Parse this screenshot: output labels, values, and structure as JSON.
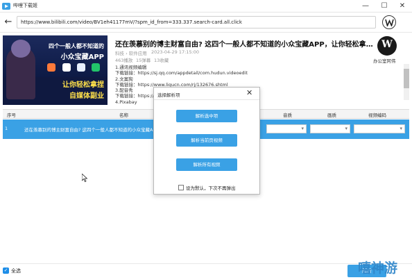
{
  "window": {
    "title": "哔哩下载姬",
    "minimize_icon": "minimize-icon",
    "maximize_icon": "maximize-icon",
    "close_icon": "close-icon"
  },
  "address": {
    "url": "https://www.bilibili.com/video/BV1eh41177mV/?spm_id_from=333.337.search-card.all.click"
  },
  "video": {
    "thumbnail_lines": [
      "四个一般人都不知道的",
      "小众宝藏APP",
      "让你轻松拿捏",
      "自媒体副业"
    ],
    "title": "还在羡慕别的博主财富自由? 这四个一般人都不知道的小众宝藏APP，让你轻松拿捏自媒体...",
    "category": "科技 › 软件应用",
    "date": "2023-04-29 17:15:00",
    "stats": [
      "463播放",
      "15弹幕",
      "13收藏"
    ],
    "description": [
      "1.通讯视频编辑",
      "下载链接：https://sj.qq.com/appdetail/com.hudun.videoedit",
      "2.文案狗",
      "下载链接：https://www.liqucn.com/rj/132676.shtml",
      "3.配音秀",
      "下载链接：https://",
      "4.Pixabay"
    ],
    "channel_name": "办公室阿伟",
    "channel_logo_text": "W"
  },
  "table": {
    "headers": [
      "序号",
      "名称",
      "音质",
      "画质",
      "视频编码"
    ],
    "rows": [
      {
        "index": "1",
        "name": "还在羡慕别的博主财富自由? 这四个一般人都不知道的小众宝藏APP，让你...",
        "audio": "",
        "quality": "",
        "codec": ""
      }
    ]
  },
  "dialog": {
    "title": "选择解析项",
    "buttons": [
      "解析选中项",
      "解析当前页视频",
      "解析所有视频"
    ],
    "checkbox_label": "设为默认，下次不再弹出"
  },
  "footer": {
    "select_all": "全选",
    "parse_button": "解析"
  },
  "watermark": "嘻神游",
  "colors": {
    "accent": "#3aa1e5",
    "row_selected": "#3aa1e5",
    "watermark": "#2f86c9"
  }
}
